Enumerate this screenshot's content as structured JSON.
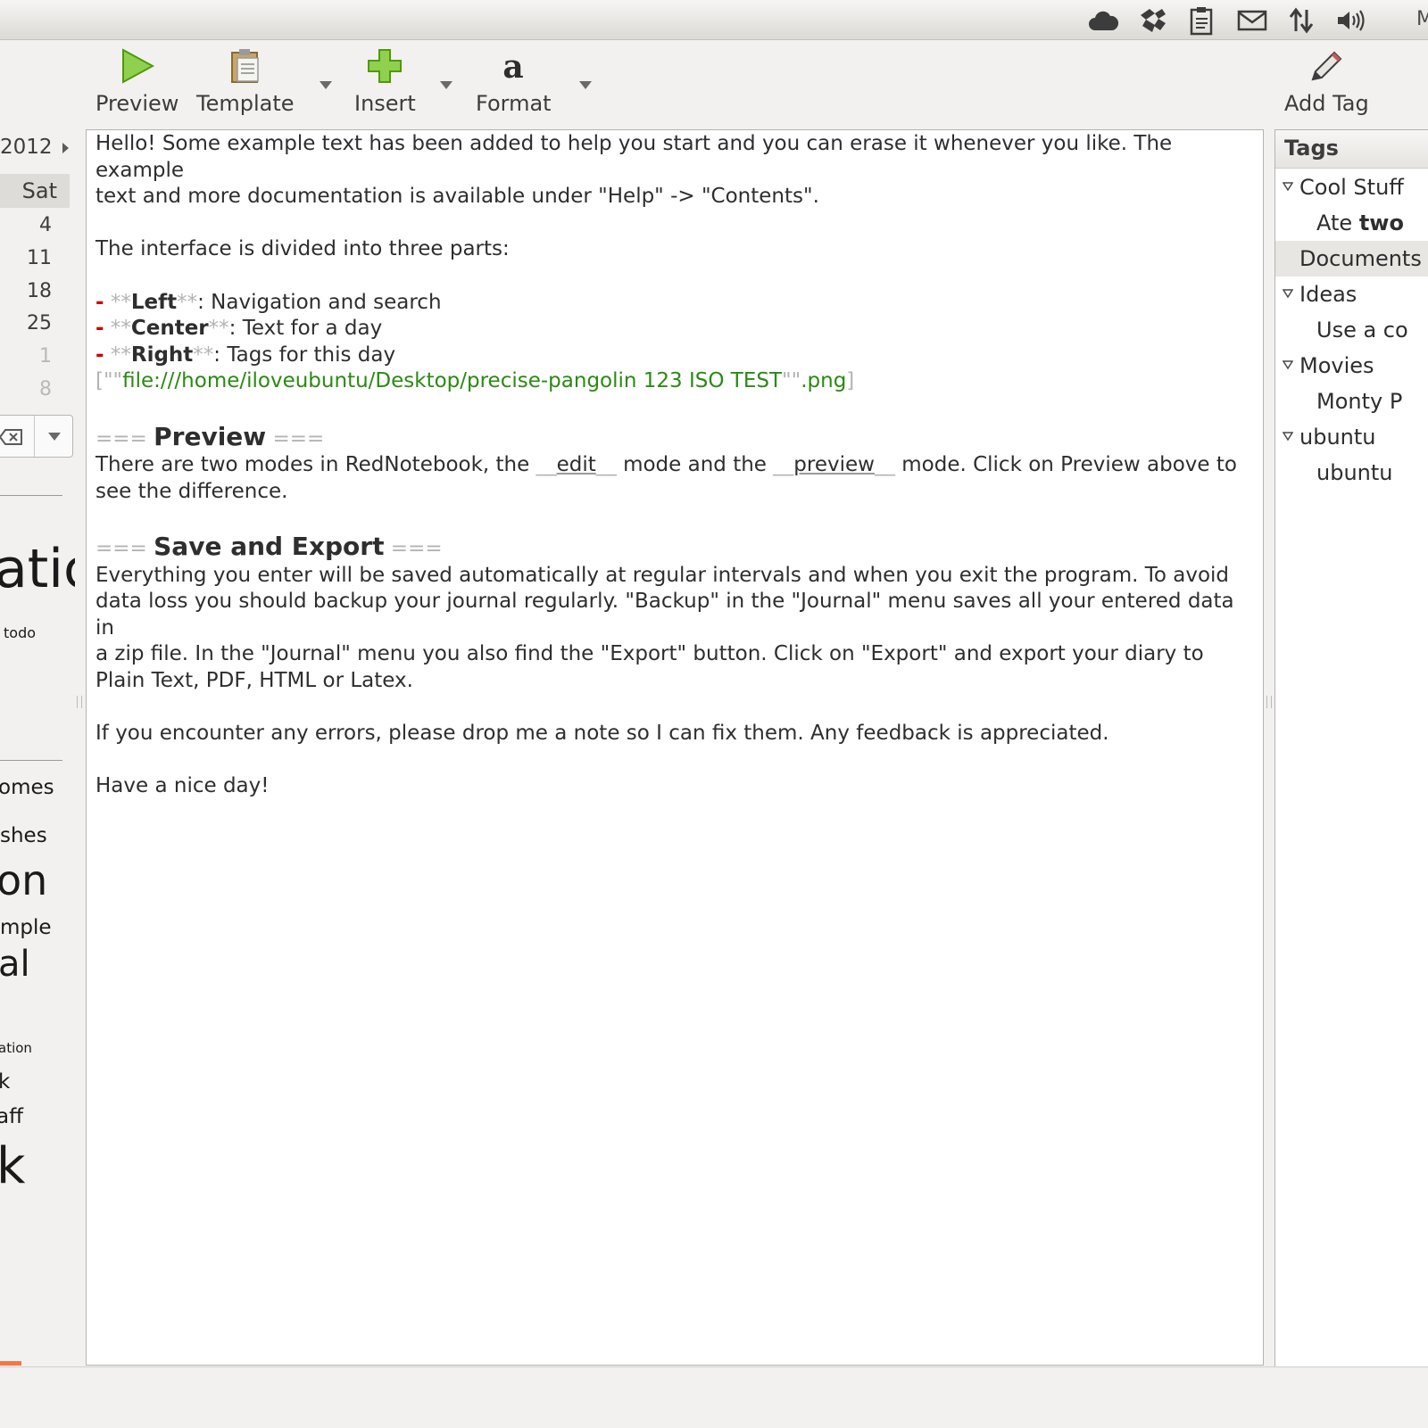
{
  "top_panel": {
    "tray_icons": [
      "cloud-icon",
      "dropbox-icon",
      "clipboard-icon",
      "mail-icon",
      "network-icon",
      "volume-icon"
    ],
    "tray_label": "M"
  },
  "toolbar": {
    "preview_label": "Preview",
    "template_label": "Template",
    "insert_label": "Insert",
    "format_label": "Format",
    "add_tag_label": "Add Tag"
  },
  "calendar": {
    "year": "2012",
    "weekday": "Sat",
    "days": [
      "4",
      "11",
      "18",
      "25"
    ],
    "other_days": [
      "1",
      "8"
    ]
  },
  "word_cloud": [
    "atic",
    "todo",
    "omes",
    "shes",
    "on",
    "mple",
    "al",
    "ation",
    "k",
    "aff",
    "k"
  ],
  "editor": {
    "intro_line1": "Hello! Some example text has been added to help you start and you can erase it whenever you like. The example",
    "intro_line2": "text and more documentation is available under \"Help\" -> \"Contents\".",
    "divided": "The interface is divided into three parts:",
    "left_label": "Left",
    "left_text": ": Navigation and search",
    "center_label": "Center",
    "center_text": ": Text for a day",
    "right_label": "Right",
    "right_text": ": Tags for this day",
    "image_link": "file:///home/iloveubuntu/Desktop/precise-pangolin 123 ISO TEST",
    "image_ext": ".png",
    "preview_heading": "Preview",
    "preview_text1": "There are two modes in RedNotebook, the ",
    "edit_word": "edit",
    "preview_text2": " mode and the ",
    "preview_word": "preview",
    "preview_text3": " mode. Click on Preview above to",
    "preview_text4": "see the difference.",
    "save_heading": "Save and Export",
    "save_line1": "Everything you enter will be saved automatically at regular intervals and when you exit the program. To avoid",
    "save_line2": "data loss you should backup your journal regularly. \"Backup\" in the \"Journal\" menu saves all your entered data in",
    "save_line3": "a zip file. In the \"Journal\" menu you also find the \"Export\" button. Click on \"Export\" and export your diary to",
    "save_line4": "Plain Text, PDF, HTML or Latex.",
    "errors_line": "If you encounter any errors, please drop me a note so I can fix them. Any feedback is appreciated.",
    "goodbye": "Have a nice day!"
  },
  "tags": {
    "header": "Tags",
    "cool_stuff": "Cool Stuff",
    "ate_prefix": "Ate ",
    "ate_bold": "two",
    "documents": "Documents",
    "ideas": "Ideas",
    "ideas_child": "Use a co",
    "movies": "Movies",
    "movies_child": "Monty P",
    "ubuntu": "ubuntu",
    "ubuntu_child": "ubuntu"
  }
}
